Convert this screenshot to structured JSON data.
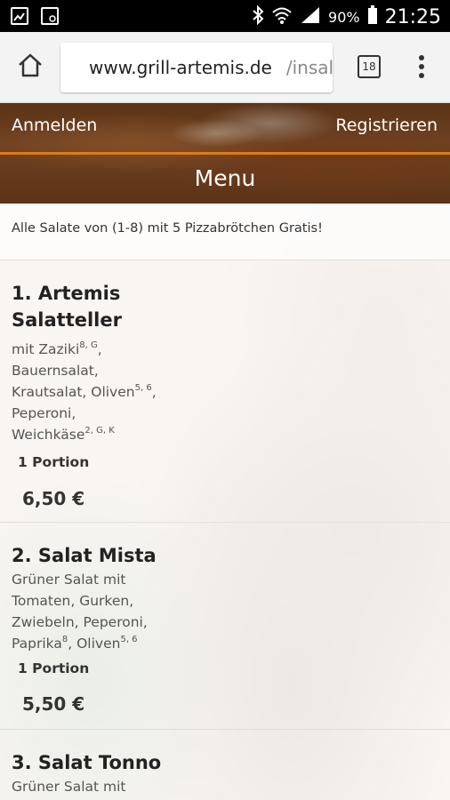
{
  "status_bar": {
    "icons_left": [
      "image-icon",
      "screen-icon"
    ],
    "battery": "90%",
    "time": "21:25"
  },
  "browser": {
    "url_host": "www.grill-artemis.de",
    "url_path": "/insalat",
    "tab_count": "18"
  },
  "header": {
    "login": "Anmelden",
    "register": "Registrieren",
    "title": "Menu"
  },
  "notice": "Alle Salate von (1-8) mit 5 Pizzabrötchen Gratis!",
  "items": [
    {
      "title_line1": "1. Artemis",
      "title_line2": "Salatteller",
      "desc": [
        {
          "text": "mit Zaziki",
          "sup": "8, G",
          "tail": ","
        },
        {
          "text": "Bauernsalat,",
          "sup": "",
          "tail": ""
        },
        {
          "text": "Krautsalat, Oliven",
          "sup": "5, 6",
          "tail": ","
        },
        {
          "text": "Peperoni,",
          "sup": "",
          "tail": ""
        },
        {
          "text": "Weichkäse",
          "sup": "2, G, K",
          "tail": ""
        }
      ],
      "portion": "1 Portion",
      "price": "6,50 €"
    },
    {
      "title_line1": "2. Salat Mista",
      "desc": [
        {
          "text": "Grüner Salat mit",
          "sup": "",
          "tail": ""
        },
        {
          "text": "Tomaten, Gurken,",
          "sup": "",
          "tail": ""
        },
        {
          "text": "Zwiebeln, Peperoni,",
          "sup": "",
          "tail": ""
        },
        {
          "text": "Paprika",
          "sup": "8",
          "tail": ", Oliven",
          "sup2": "5, 6"
        }
      ],
      "portion": "1 Portion",
      "price": "5,50 €"
    },
    {
      "title_line1": "3. Salat Tonno",
      "desc": [
        {
          "text": "Grüner Salat mit",
          "sup": "",
          "tail": ""
        }
      ]
    }
  ]
}
